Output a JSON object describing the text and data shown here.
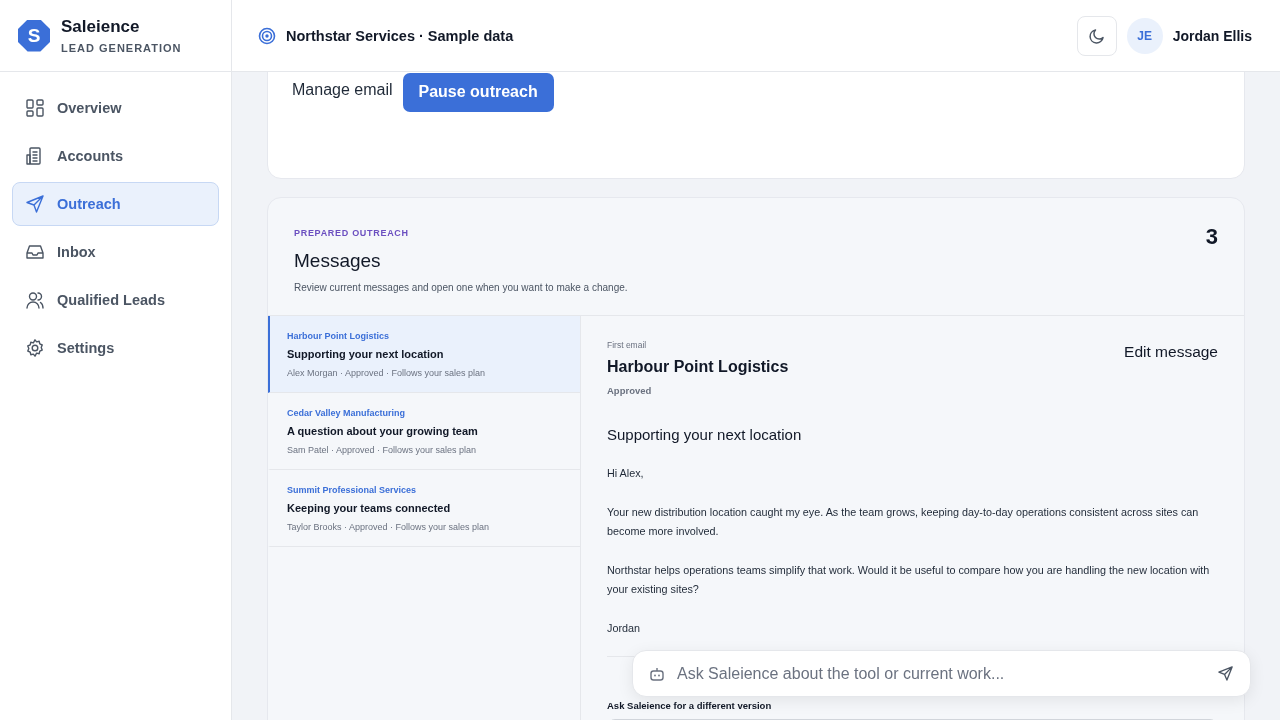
{
  "brand": {
    "name": "Saleience",
    "subtitle": "LEAD GENERATION",
    "logo_letter": "S"
  },
  "sidebar": {
    "items": [
      {
        "label": "Overview",
        "selected": false
      },
      {
        "label": "Accounts",
        "selected": false
      },
      {
        "label": "Outreach",
        "selected": true
      },
      {
        "label": "Inbox",
        "selected": false
      },
      {
        "label": "Qualified Leads",
        "selected": false
      },
      {
        "label": "Settings",
        "selected": false
      }
    ]
  },
  "header": {
    "workspace": "Northstar Services · Sample data",
    "user": {
      "initials": "JE",
      "name": "Jordan Ellis"
    }
  },
  "control_card": {
    "label": "Manage email",
    "button": "Pause outreach"
  },
  "messages_panel": {
    "eyebrow": "PREPARED OUTREACH",
    "title": "Messages",
    "description": "Review current messages and open one when you want to make a change.",
    "count": "3",
    "messages": [
      {
        "company": "Harbour Point Logistics",
        "subject": "Supporting your next location",
        "meta": "Alex Morgan · Approved · Follows your sales plan",
        "selected": true
      },
      {
        "company": "Cedar Valley Manufacturing",
        "subject": "A question about your growing team",
        "meta": "Sam Patel · Approved · Follows your sales plan",
        "selected": false
      },
      {
        "company": "Summit Professional Services",
        "subject": "Keeping your teams connected",
        "meta": "Taylor Brooks · Approved · Follows your sales plan",
        "selected": false
      }
    ],
    "detail": {
      "step": "First email",
      "company": "Harbour Point Logistics",
      "status": "Approved",
      "edit_button": "Edit message",
      "subject": "Supporting your next location",
      "body": [
        "Hi Alex,",
        "Your new distribution location caught my eye. As the team grows, keeping day-to-day operations consistent across sites can become more involved.",
        "Northstar helps operations teams simplify that work. Would it be useful to compare how you are handling the new location with your existing sites?",
        "Jordan"
      ],
      "revision_label": "Ask Saleience for a different version"
    }
  },
  "assistant": {
    "placeholder": "Ask Saleience about the tool or current work..."
  }
}
